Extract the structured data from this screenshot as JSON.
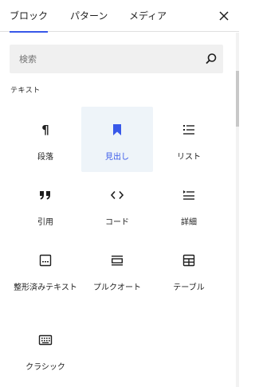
{
  "tabs": {
    "items": [
      {
        "label": "ブロック",
        "active": true
      },
      {
        "label": "パターン",
        "active": false
      },
      {
        "label": "メディア",
        "active": false
      }
    ],
    "close_icon": "close-icon"
  },
  "search": {
    "placeholder": "検索",
    "value": "",
    "icon": "search-icon"
  },
  "section": {
    "title": "テキスト"
  },
  "blocks": [
    {
      "label": "段落",
      "icon": "paragraph-icon",
      "highlighted": false
    },
    {
      "label": "見出し",
      "icon": "bookmark-icon",
      "highlighted": true
    },
    {
      "label": "リスト",
      "icon": "list-icon",
      "highlighted": false
    },
    {
      "label": "引用",
      "icon": "quote-icon",
      "highlighted": false
    },
    {
      "label": "コード",
      "icon": "code-icon",
      "highlighted": false
    },
    {
      "label": "詳細",
      "icon": "details-icon",
      "highlighted": false
    },
    {
      "label": "整形済みテキスト",
      "icon": "preformatted-icon",
      "highlighted": false
    },
    {
      "label": "プルクオート",
      "icon": "pullquote-icon",
      "highlighted": false
    },
    {
      "label": "テーブル",
      "icon": "table-icon",
      "highlighted": false
    },
    {
      "label": "クラシック",
      "icon": "keyboard-icon",
      "highlighted": false
    }
  ],
  "colors": {
    "accent": "#3858e9",
    "highlight_bg": "#eef4f9",
    "search_bg": "#f0f0f0"
  }
}
